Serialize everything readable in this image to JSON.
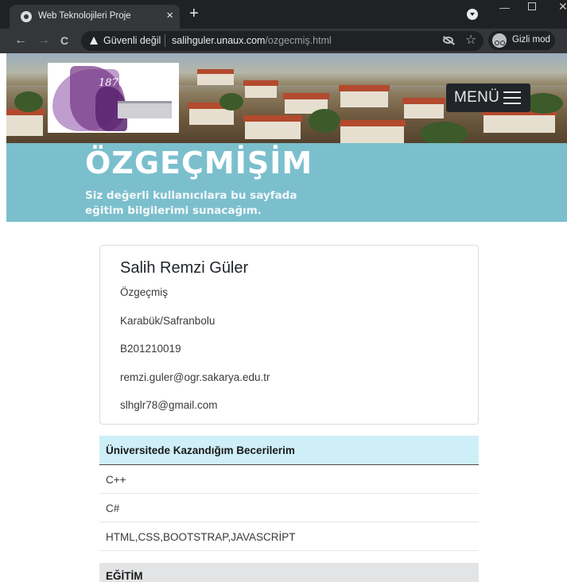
{
  "browser": {
    "tab_title": "Web Teknolojileri Proje",
    "tab_close": "×",
    "new_tab": "+",
    "security_label": "Güvenli değil",
    "url_host": "salihguler.unaux.com",
    "url_path": "/ozgecmiş.html",
    "incognito_label": "Gizli mod",
    "nav_back": "←",
    "nav_forward": "→",
    "nav_reload": "C",
    "bookmark_star": "☆",
    "window_minimize": "—",
    "window_close": "✕"
  },
  "banner": {
    "logo_year": "1870",
    "menu_label": "MENÜ"
  },
  "hero": {
    "title": "ÖZGEÇMİŞİM",
    "subtitle_line1": "Siz değerli kullanıcılara bu sayfada",
    "subtitle_line2": "eğitim bilgilerimi sunacağım."
  },
  "profile": {
    "name": "Salih Remzi Güler",
    "lines": [
      "Özgeçmiş",
      "Karabük/Safranbolu",
      "B201210019",
      "remzi.guler@ogr.sakarya.edu.tr",
      "slhglr78@gmail.com"
    ]
  },
  "skills": {
    "header": "Üniversitede Kazandığım Becerilerim",
    "items": [
      "C++",
      "C#",
      "HTML,CSS,BOOTSTRAP,JAVASCRİPT"
    ]
  },
  "education": {
    "header": "EĞİTİM"
  },
  "colors": {
    "hero_bg": "#7bbfcd",
    "skills_header_bg": "#cfeff8",
    "education_header_bg": "#e3e4e6",
    "menu_bg": "#212529",
    "chrome_dark": "#202124",
    "chrome_toolbar": "#35363a"
  },
  "icons": [
    "globe-icon",
    "close-icon",
    "plus-icon",
    "dropdown-icon",
    "back-arrow-icon",
    "forward-arrow-icon",
    "reload-icon",
    "warning-icon",
    "eye-off-icon",
    "star-icon",
    "incognito-icon",
    "hamburger-icon"
  ]
}
